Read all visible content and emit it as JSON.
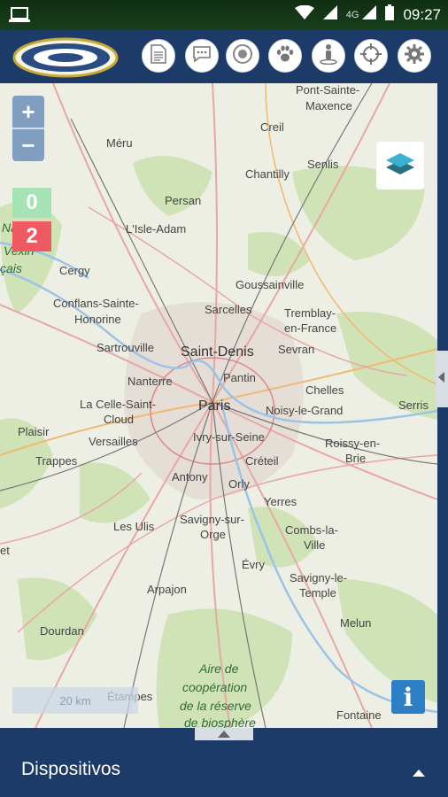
{
  "status_bar": {
    "network_label": "4G",
    "time": "09:27"
  },
  "toolbar": {
    "buttons": [
      "document-icon",
      "chat-icon",
      "target-icon",
      "paw-icon",
      "person-pin-icon",
      "crosshair-icon",
      "gear-icon"
    ]
  },
  "map": {
    "zoom_in": "+",
    "zoom_out": "−",
    "counter_green": "0",
    "counter_red": "2",
    "scale": "20 km",
    "info": "i",
    "colors": {
      "green_counter": "#a6e3b4",
      "red_counter": "#ef5a62",
      "info": "#2c7fc4"
    },
    "places": [
      {
        "name": "Pont-Sainte-",
        "line2": "Maxence"
      },
      {
        "name": "Creil"
      },
      {
        "name": "Senlis"
      },
      {
        "name": "Méru"
      },
      {
        "name": "Chantilly"
      },
      {
        "name": "Persan"
      },
      {
        "name": "L'Isle-Adam"
      },
      {
        "name": "Cergy"
      },
      {
        "name": "Goussainville"
      },
      {
        "name": "Conflans-Sainte-",
        "line2": "Honorine"
      },
      {
        "name": "Sarcelles"
      },
      {
        "name": "Tremblay-",
        "line2": "en-France"
      },
      {
        "name": "Sartrouville"
      },
      {
        "name": "Saint-Denis"
      },
      {
        "name": "Sevran"
      },
      {
        "name": "Nanterre"
      },
      {
        "name": "Pantin"
      },
      {
        "name": "Chelles"
      },
      {
        "name": "La Celle-Saint-",
        "line2": "Cloud"
      },
      {
        "name": "Paris"
      },
      {
        "name": "Noisy-le-Grand"
      },
      {
        "name": "Serris"
      },
      {
        "name": "Plaisir"
      },
      {
        "name": "Versailles"
      },
      {
        "name": "Ivry-sur-Seine"
      },
      {
        "name": "Roissy-en-",
        "line2": "Brie"
      },
      {
        "name": "Trappes"
      },
      {
        "name": "Créteil"
      },
      {
        "name": "Antony"
      },
      {
        "name": "Orly"
      },
      {
        "name": "Yerres"
      },
      {
        "name": "Savigny-sur-",
        "line2": "Orge"
      },
      {
        "name": "Les Ulis"
      },
      {
        "name": "Combs-la-",
        "line2": "Ville"
      },
      {
        "name": "Évry"
      },
      {
        "name": "Savigny-le-",
        "line2": "Temple"
      },
      {
        "name": "Arpajon"
      },
      {
        "name": "Melun"
      },
      {
        "name": "Dourdan"
      },
      {
        "name": "Étampes"
      },
      {
        "name": "Fontaine"
      },
      {
        "name": "Aire de",
        "line2": "coopération",
        "line3": "de la réserve",
        "line4": "de biosphère"
      },
      {
        "name": "Naturel",
        "line2": "Vexin",
        "line3": "çais"
      },
      {
        "name": "et"
      }
    ]
  },
  "bottom_panel": {
    "title": "Dispositivos"
  }
}
